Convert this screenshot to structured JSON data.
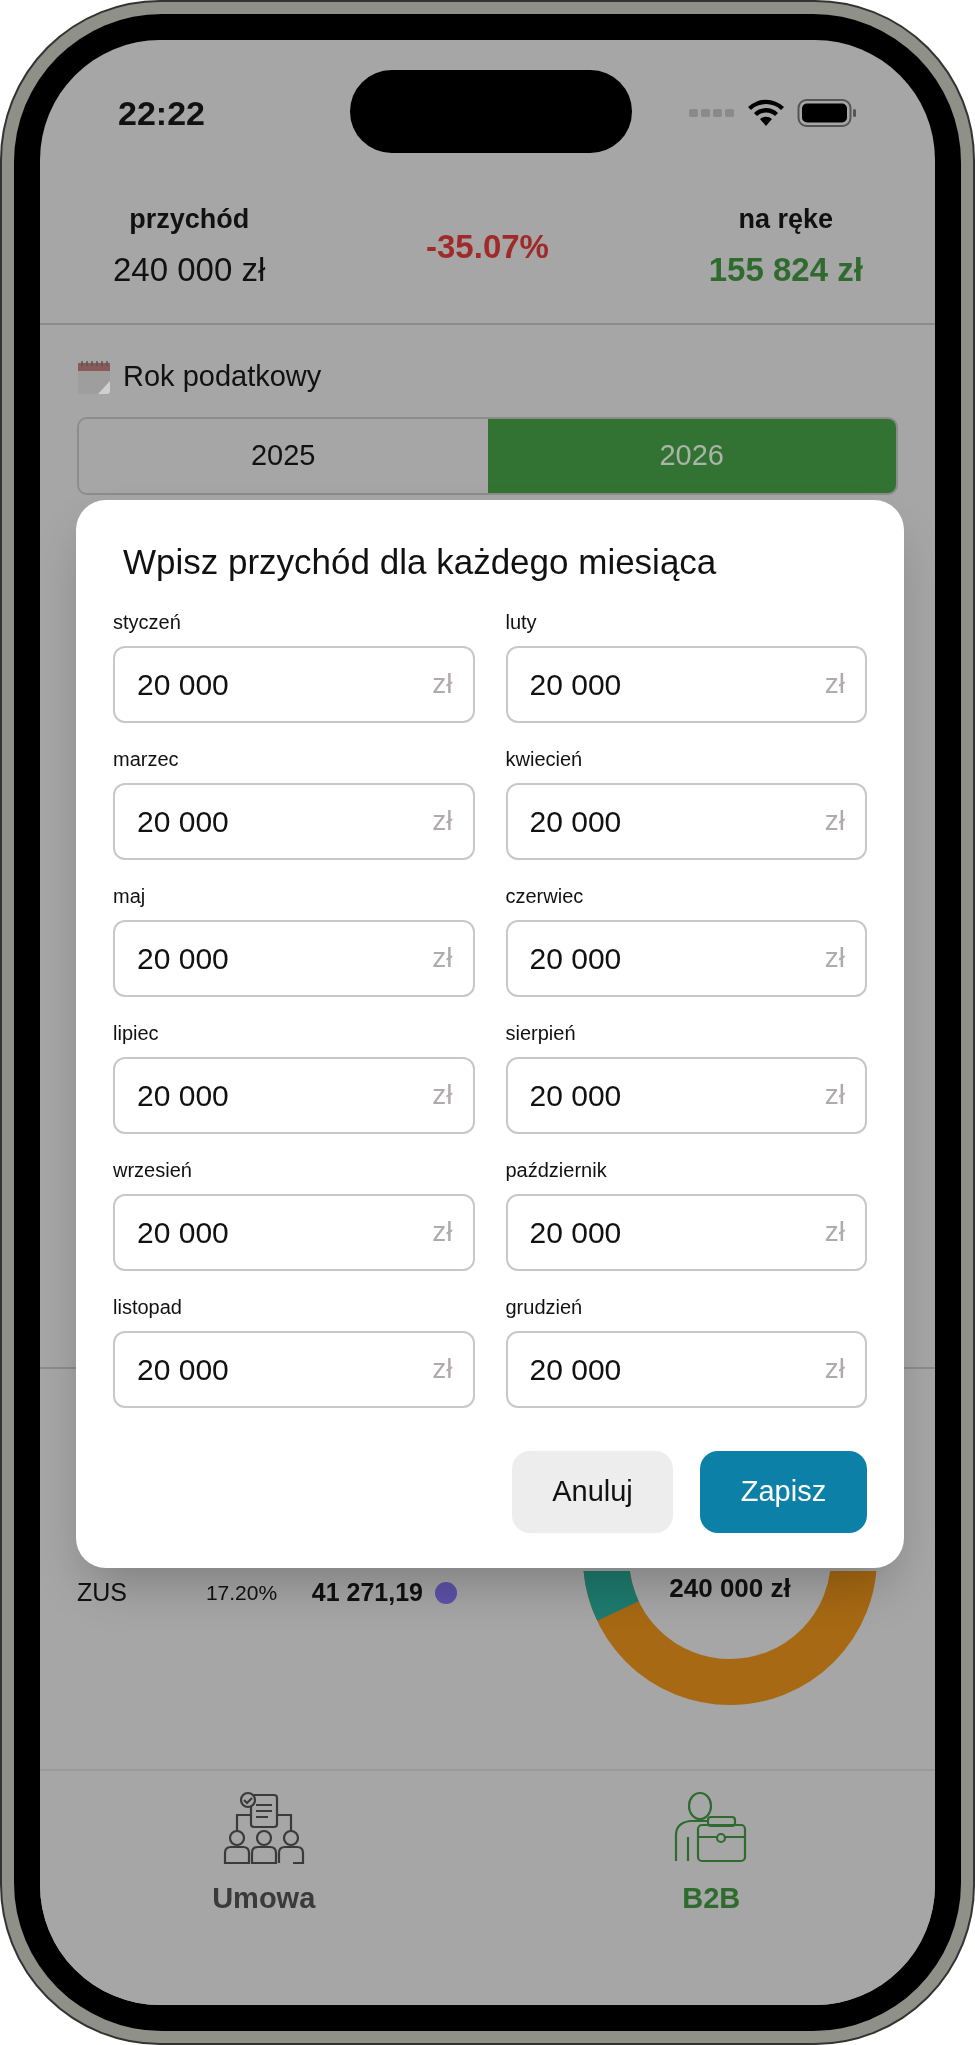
{
  "status_bar": {
    "time": "22:22"
  },
  "summary": {
    "income_label": "przychód",
    "income_value": "240 000 zł",
    "change": "-35.07%",
    "net_label": "na ręke",
    "net_value": "155 824 zł"
  },
  "tax_year": {
    "label": "Rok podatkowy",
    "options": [
      {
        "label": "2025",
        "selected": false
      },
      {
        "label": "2026",
        "selected": true
      }
    ]
  },
  "breakdown": {
    "rows": [
      {
        "name": "ZUS",
        "percent": "17.20%",
        "amount": "41 271,19",
        "color": "#5d52a8"
      }
    ],
    "donut_center": "240 000 zł"
  },
  "modal": {
    "title": "Wpisz przychód dla każdego miesiąca",
    "months": [
      {
        "label": "styczeń",
        "value": "20 000",
        "unit": "zł"
      },
      {
        "label": "luty",
        "value": "20 000",
        "unit": "zł"
      },
      {
        "label": "marzec",
        "value": "20 000",
        "unit": "zł"
      },
      {
        "label": "kwiecień",
        "value": "20 000",
        "unit": "zł"
      },
      {
        "label": "maj",
        "value": "20 000",
        "unit": "zł"
      },
      {
        "label": "czerwiec",
        "value": "20 000",
        "unit": "zł"
      },
      {
        "label": "lipiec",
        "value": "20 000",
        "unit": "zł"
      },
      {
        "label": "sierpień",
        "value": "20 000",
        "unit": "zł"
      },
      {
        "label": "wrzesień",
        "value": "20 000",
        "unit": "zł"
      },
      {
        "label": "październik",
        "value": "20 000",
        "unit": "zł"
      },
      {
        "label": "listopad",
        "value": "20 000",
        "unit": "zł"
      },
      {
        "label": "grudzień",
        "value": "20 000",
        "unit": "zł"
      }
    ],
    "buttons": [
      {
        "label": "Anuluj",
        "kind": "secondary"
      },
      {
        "label": "Zapisz",
        "kind": "primary"
      }
    ]
  },
  "tabs": [
    {
      "label": "Umowa",
      "selected": false
    },
    {
      "label": "B2B",
      "selected": true
    }
  ]
}
